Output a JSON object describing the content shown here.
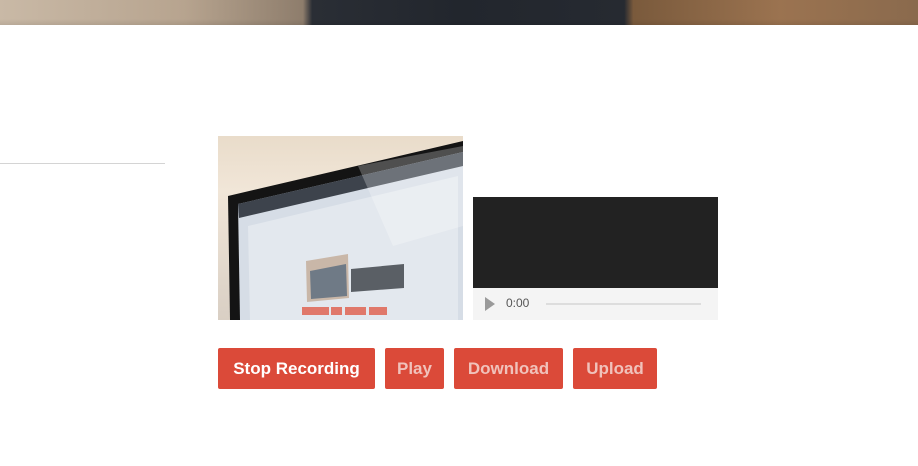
{
  "player": {
    "time": "0:00"
  },
  "buttons": {
    "stop_recording": "Stop Recording",
    "play": "Play",
    "download": "Download",
    "upload": "Upload"
  },
  "colors": {
    "button": "#db4a39",
    "player_screen": "#222222",
    "player_controls": "#f4f4f4"
  },
  "icons": [
    "play-icon"
  ]
}
